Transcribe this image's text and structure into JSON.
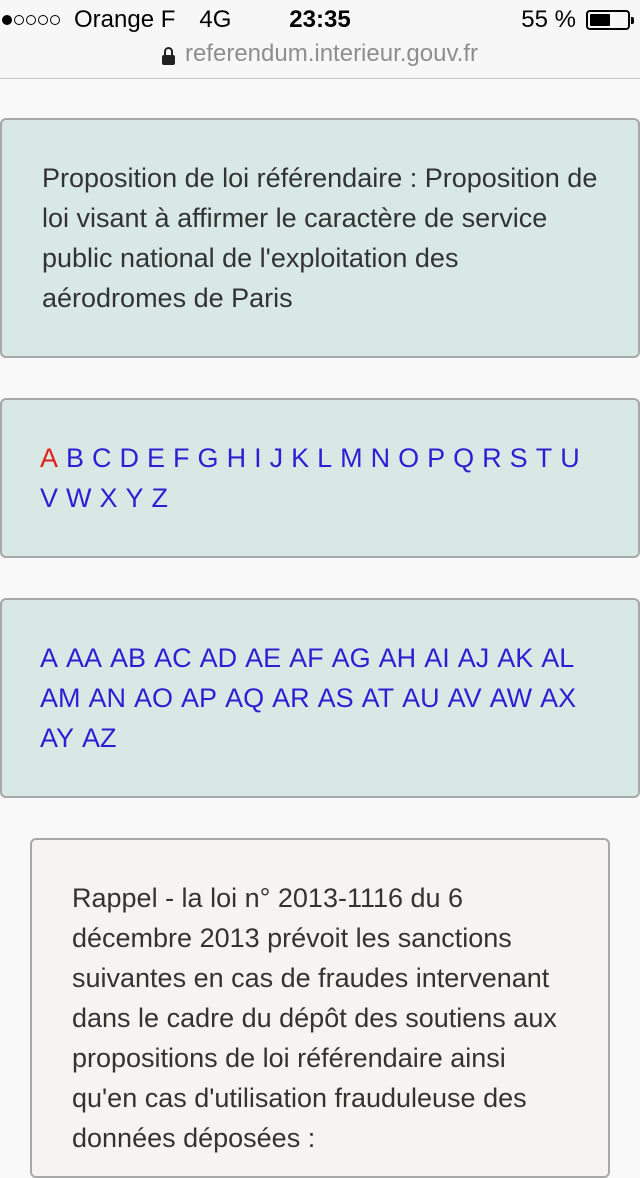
{
  "status_bar": {
    "signal_dots": [
      true,
      false,
      false,
      false,
      false
    ],
    "carrier": "Orange F",
    "network": "4G",
    "time": "23:35",
    "battery_text": "55 %",
    "battery_level": 0.55
  },
  "url_bar": {
    "url": "referendum.interieur.gouv.fr",
    "icon": "lock-icon"
  },
  "title_box": {
    "text": "Proposition de loi référendaire : Proposition de loi visant à affirmer le caractère de service public national de l'exploitation des aérodromes de Paris"
  },
  "letter_index": {
    "selected": "A",
    "letters": [
      "A",
      "B",
      "C",
      "D",
      "E",
      "F",
      "G",
      "H",
      "I",
      "J",
      "K",
      "L",
      "M",
      "N",
      "O",
      "P",
      "Q",
      "R",
      "S",
      "T",
      "U",
      "V",
      "W",
      "X",
      "Y",
      "Z"
    ]
  },
  "prefix_index": {
    "prefixes": [
      "A",
      "AA",
      "AB",
      "AC",
      "AD",
      "AE",
      "AF",
      "AG",
      "AH",
      "AI",
      "AJ",
      "AK",
      "AL",
      "AM",
      "AN",
      "AO",
      "AP",
      "AQ",
      "AR",
      "AS",
      "AT",
      "AU",
      "AV",
      "AW",
      "AX",
      "AY",
      "AZ"
    ]
  },
  "rappel_box": {
    "text": "Rappel - la loi n° 2013-1116 du 6 décembre 2013 prévoit les sanctions suivantes en cas de fraudes intervenant dans le cadre du dépôt des soutiens aux propositions de loi référendaire ainsi qu'en cas d'utilisation frauduleuse des données déposées :"
  },
  "colors": {
    "link": "#2d1fd4",
    "link_active": "#e0221a",
    "box_bg": "#d8e8e4",
    "rappel_bg": "#f7f3f0"
  }
}
